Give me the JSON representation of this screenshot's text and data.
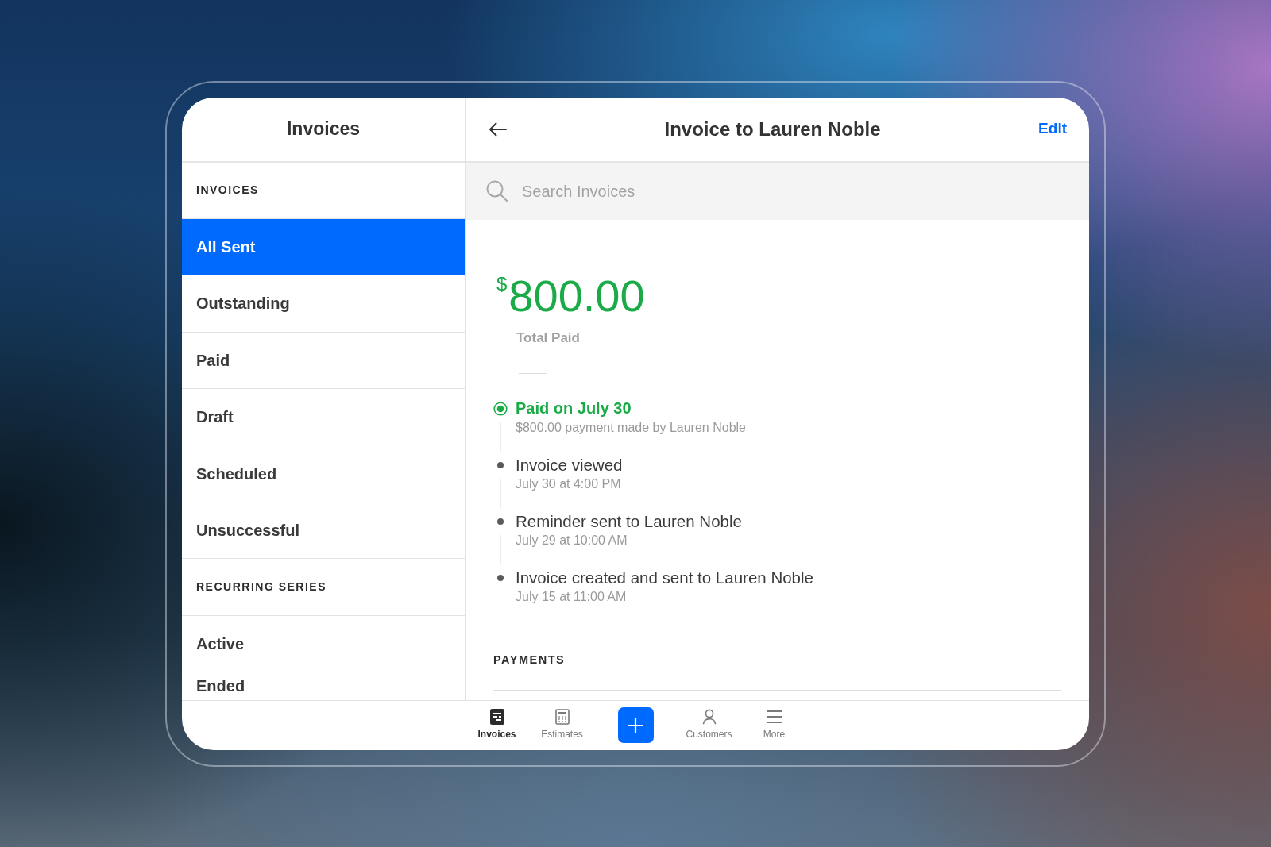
{
  "sidebar": {
    "title": "Invoices",
    "sections": [
      {
        "heading": "INVOICES",
        "items": [
          {
            "label": "All Sent",
            "selected": true
          },
          {
            "label": "Outstanding",
            "selected": false
          },
          {
            "label": "Paid",
            "selected": false
          },
          {
            "label": "Draft",
            "selected": false
          },
          {
            "label": "Scheduled",
            "selected": false
          },
          {
            "label": "Unsuccessful",
            "selected": false
          }
        ]
      },
      {
        "heading": "RECURRING SERIES",
        "items": [
          {
            "label": "Active",
            "selected": false
          },
          {
            "label": "Ended",
            "selected": false
          }
        ]
      }
    ]
  },
  "detail": {
    "title": "Invoice to Lauren Noble",
    "action": "Edit",
    "search": {
      "placeholder": "Search Invoices"
    },
    "currency_symbol": "$",
    "amount": "800.00",
    "amount_label": "Total Paid",
    "timeline": [
      {
        "kind": "paid",
        "title": "Paid on July 30",
        "subtitle": "$800.00 payment made by Lauren Noble"
      },
      {
        "kind": "event",
        "title": "Invoice viewed",
        "subtitle": "July 30 at 4:00 PM"
      },
      {
        "kind": "event",
        "title": "Reminder sent to Lauren Noble",
        "subtitle": "July 29 at 10:00 AM"
      },
      {
        "kind": "event",
        "title": "Invoice created and sent to Lauren Noble",
        "subtitle": "July 15 at 11:00 AM"
      }
    ],
    "payments_heading": "PAYMENTS"
  },
  "tab_bar": {
    "items": [
      {
        "kind": "tab",
        "label": "Invoices",
        "selected": true
      },
      {
        "kind": "tab",
        "label": "Estimates",
        "selected": false
      },
      {
        "kind": "add"
      },
      {
        "kind": "tab",
        "label": "Customers",
        "selected": false
      },
      {
        "kind": "tab",
        "label": "More",
        "selected": false
      }
    ]
  }
}
